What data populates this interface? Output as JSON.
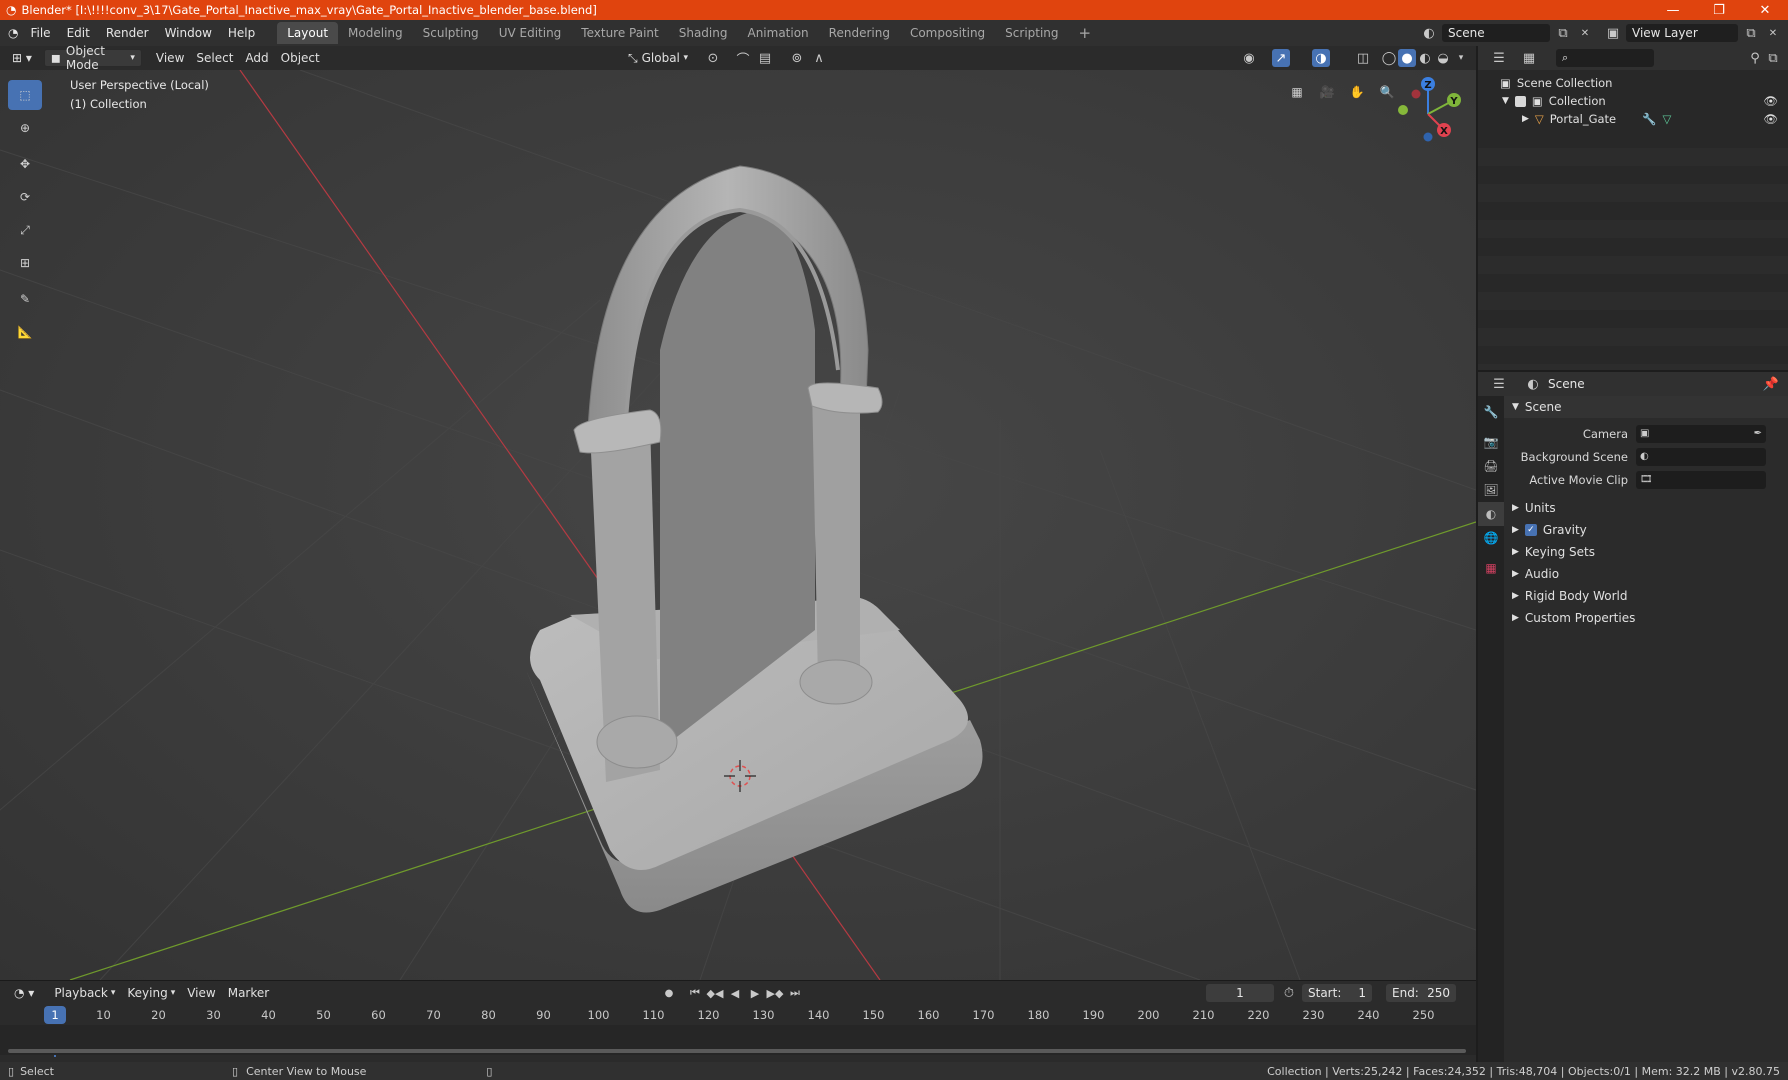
{
  "window": {
    "title": "Blender* [I:\\!!!!conv_3\\17\\Gate_Portal_Inactive_max_vray\\Gate_Portal_Inactive_blender_base.blend]",
    "controls": [
      "minimize-icon",
      "restore-icon",
      "close-icon"
    ]
  },
  "menus": [
    "File",
    "Edit",
    "Render",
    "Window",
    "Help"
  ],
  "workspaces": [
    {
      "label": "Layout",
      "active": true
    },
    {
      "label": "Modeling"
    },
    {
      "label": "Sculpting"
    },
    {
      "label": "UV Editing"
    },
    {
      "label": "Texture Paint"
    },
    {
      "label": "Shading"
    },
    {
      "label": "Animation"
    },
    {
      "label": "Rendering"
    },
    {
      "label": "Compositing"
    },
    {
      "label": "Scripting"
    }
  ],
  "scene_selector": {
    "value": "Scene"
  },
  "view_layer_selector": {
    "value": "View Layer"
  },
  "viewport_header": {
    "mode": "Object Mode",
    "menus": [
      "View",
      "Select",
      "Add",
      "Object"
    ],
    "transform_orientation": "Global"
  },
  "viewport": {
    "perspective_label": "User Perspective (Local)",
    "collection_label": "(1) Collection",
    "gizmo_axes": [
      "Z",
      "Y",
      "X"
    ]
  },
  "outliner": {
    "root": "Scene Collection",
    "items": [
      {
        "label": "Collection",
        "level": 1
      },
      {
        "label": "Portal_Gate",
        "level": 2
      }
    ]
  },
  "properties": {
    "context": "Scene",
    "section_title": "Scene",
    "fields": [
      {
        "label": "Camera",
        "value": ""
      },
      {
        "label": "Background Scene",
        "value": ""
      },
      {
        "label": "Active Movie Clip",
        "value": ""
      }
    ],
    "panels": [
      "Units",
      "Gravity",
      "Keying Sets",
      "Audio",
      "Rigid Body World",
      "Custom Properties"
    ]
  },
  "timeline": {
    "menus": [
      "Playback",
      "Keying",
      "View",
      "Marker"
    ],
    "current_frame": "1",
    "start_label": "Start:",
    "start_value": "1",
    "end_label": "End:",
    "end_value": "250",
    "ruler": [
      "1",
      "10",
      "20",
      "30",
      "40",
      "50",
      "60",
      "70",
      "80",
      "90",
      "100",
      "110",
      "120",
      "130",
      "140",
      "150",
      "160",
      "170",
      "180",
      "190",
      "200",
      "210",
      "220",
      "230",
      "240",
      "250"
    ]
  },
  "statusbar": {
    "left_action": "Select",
    "middle_action": "Center View to Mouse",
    "stats": "Collection | Verts:25,242 | Faces:24,352 | Tris:48,704 | Objects:0/1 | Mem: 32.2 MB | v2.80.75"
  },
  "colors": {
    "accent": "#4772b3",
    "titlebar": "#e0440e",
    "x_axis": "#e0424f",
    "y_axis": "#7fb53a",
    "z_axis": "#3b7fe0"
  }
}
